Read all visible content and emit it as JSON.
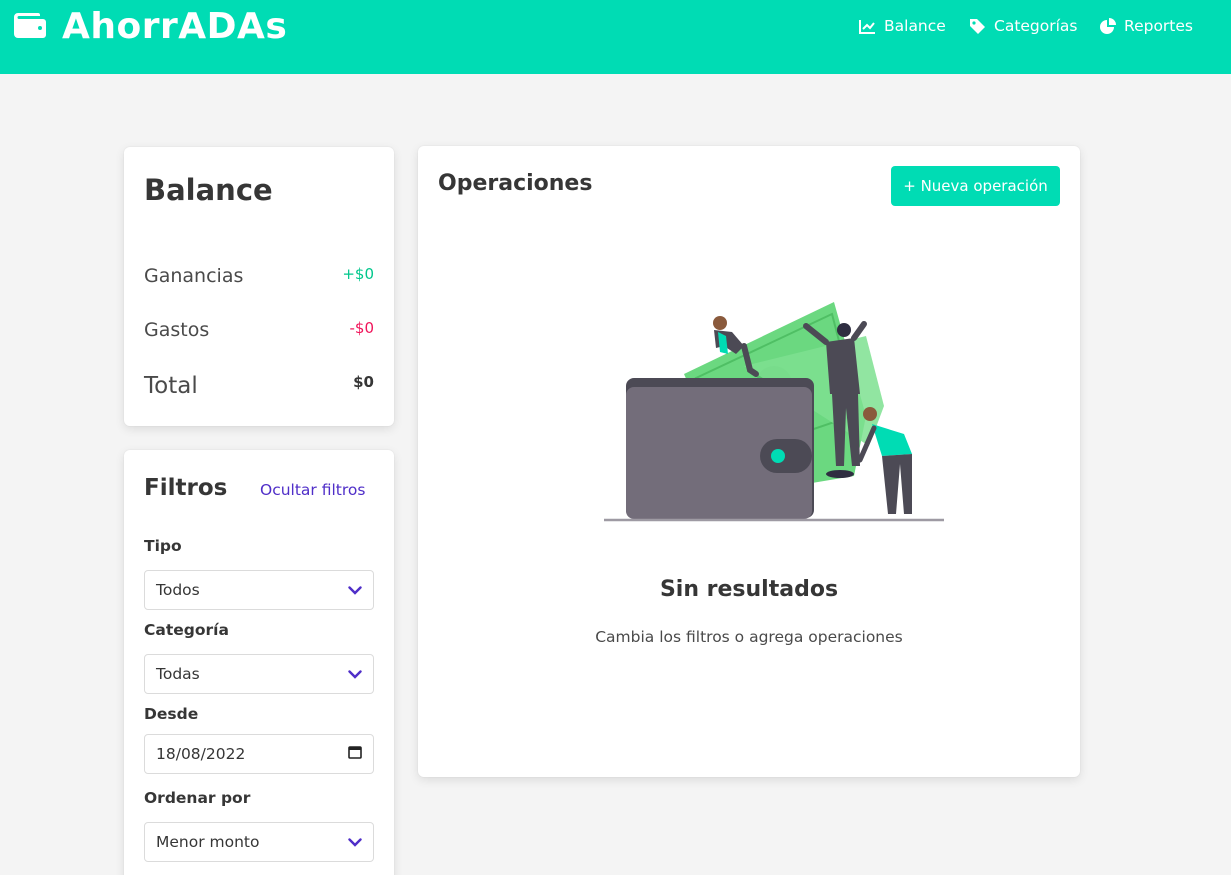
{
  "app": {
    "title": "AhorrADAs",
    "brand_icon": "wallet-icon"
  },
  "nav": [
    {
      "label": "Balance",
      "icon": "chart-line-icon"
    },
    {
      "label": "Categorías",
      "icon": "tag-icon"
    },
    {
      "label": "Reportes",
      "icon": "pie-chart-icon"
    }
  ],
  "balance": {
    "title": "Balance",
    "rows": [
      {
        "label": "Ganancias",
        "value": "+$0",
        "color": "#00c78c"
      },
      {
        "label": "Gastos",
        "value": "-$0",
        "color": "#f0145a"
      },
      {
        "label": "Total",
        "value": "$0",
        "color": "#363636"
      }
    ]
  },
  "filters": {
    "title": "Filtros",
    "toggle_label": "Ocultar filtros",
    "type": {
      "label": "Tipo",
      "value": "Todos"
    },
    "category": {
      "label": "Categoría",
      "value": "Todas"
    },
    "from": {
      "label": "Desde",
      "value": "18/08/2022"
    },
    "sort": {
      "label": "Ordenar por",
      "value": "Menor monto"
    }
  },
  "operations": {
    "title": "Operaciones",
    "new_button_label": "+ Nueva operación",
    "empty_title": "Sin resultados",
    "empty_subtitle": "Cambia los filtros o agrega operaciones"
  },
  "colors": {
    "accent": "#00dcb4",
    "link": "#4f2ec8",
    "income": "#00c78c",
    "expense": "#f0145a"
  }
}
